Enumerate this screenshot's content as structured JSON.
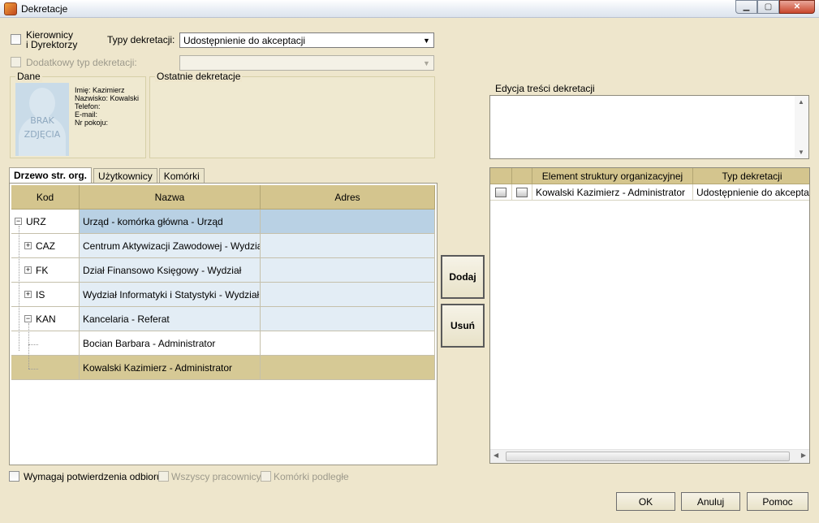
{
  "window": {
    "title": "Dekretacje"
  },
  "filters": {
    "kierownicy_label": "Kierownicy\ni Dyrektorzy",
    "typy_label": "Typy dekretacji:",
    "typy_value": "Udostępnienie do akceptacji",
    "dodatkowy_label": "Dodatkowy typ dekretacji:",
    "dodatkowy_value": ""
  },
  "dane": {
    "title": "Dane",
    "photo_text": "BRAK\nZDJĘCIA",
    "imie": "Imię: Kazimierz",
    "nazwisko": "Nazwisko: Kowalski",
    "telefon": "Telefon:",
    "email": "E-mail:",
    "pokoj": "Nr pokoju:"
  },
  "ostatnie": {
    "title": "Ostatnie dekretacje"
  },
  "tabs": [
    {
      "label": "Drzewo str. org."
    },
    {
      "label": "Użytkownicy"
    },
    {
      "label": "Komórki"
    }
  ],
  "tree": {
    "headers": [
      "Kod",
      "Nazwa",
      "Adres"
    ],
    "rows": [
      {
        "kod": "URZ",
        "nazwa": "Urząd - komórka główna - Urząd",
        "adres": "",
        "expander": "−"
      },
      {
        "kod": "CAZ",
        "nazwa": "Centrum Aktywizacji Zawodowej - Wydział",
        "adres": "",
        "expander": "+"
      },
      {
        "kod": "FK",
        "nazwa": "Dział Finansowo Księgowy - Wydział",
        "adres": "",
        "expander": "+"
      },
      {
        "kod": "IS",
        "nazwa": "Wydział Informatyki i Statystyki - Wydział",
        "adres": "",
        "expander": "+"
      },
      {
        "kod": "KAN",
        "nazwa": "Kancelaria - Referat",
        "adres": "",
        "expander": "−"
      },
      {
        "kod": "",
        "nazwa": "Bocian Barbara - Administrator",
        "adres": "",
        "expander": ""
      },
      {
        "kod": "",
        "nazwa": "Kowalski Kazimierz - Administrator",
        "adres": "",
        "expander": ""
      }
    ]
  },
  "actions": {
    "dodaj": "Dodaj",
    "usun": "Usuń"
  },
  "edycja": {
    "label": "Edycja treści dekretacji",
    "value": ""
  },
  "dekretacje": {
    "headers": [
      "Element struktury organizacyjnej",
      "Typ dekretacji"
    ],
    "rows": [
      {
        "element": "Kowalski Kazimierz - Administrator",
        "typ": "Udostępnienie do akceptacji"
      }
    ]
  },
  "bottom": {
    "wymagaj": "Wymagaj potwierdzenia odbioru",
    "wszyscy": "Wszyscy pracownicy",
    "komorki": "Komórki podległe"
  },
  "footer": {
    "ok": "OK",
    "anuluj": "Anuluj",
    "pomoc": "Pomoc"
  },
  "colors": {
    "background": "#eee6cc",
    "header": "#d4c58e",
    "selected_row": "#b9d1e4",
    "highlight_row": "#d6c995",
    "alt_row": "#e3edf5"
  }
}
